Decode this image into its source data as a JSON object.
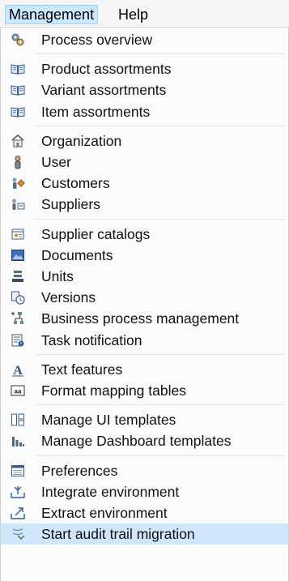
{
  "menubar": {
    "management": "Management",
    "help": "Help"
  },
  "menu": {
    "groups": [
      [
        {
          "label": "Process overview",
          "icon": "process-overview-icon"
        }
      ],
      [
        {
          "label": "Product assortments",
          "icon": "product-assortments-icon"
        },
        {
          "label": "Variant assortments",
          "icon": "variant-assortments-icon"
        },
        {
          "label": "Item assortments",
          "icon": "item-assortments-icon"
        }
      ],
      [
        {
          "label": "Organization",
          "icon": "organization-icon"
        },
        {
          "label": "User",
          "icon": "user-icon"
        },
        {
          "label": "Customers",
          "icon": "customers-icon"
        },
        {
          "label": "Suppliers",
          "icon": "suppliers-icon"
        }
      ],
      [
        {
          "label": "Supplier catalogs",
          "icon": "supplier-catalogs-icon"
        },
        {
          "label": "Documents",
          "icon": "documents-icon"
        },
        {
          "label": "Units",
          "icon": "units-icon"
        },
        {
          "label": "Versions",
          "icon": "versions-icon"
        },
        {
          "label": "Business process management",
          "icon": "business-process-management-icon"
        },
        {
          "label": "Task notification",
          "icon": "task-notification-icon"
        }
      ],
      [
        {
          "label": "Text features",
          "icon": "text-features-icon"
        },
        {
          "label": "Format mapping tables",
          "icon": "format-mapping-tables-icon"
        }
      ],
      [
        {
          "label": "Manage UI templates",
          "icon": "manage-ui-templates-icon"
        },
        {
          "label": "Manage Dashboard templates",
          "icon": "manage-dashboard-templates-icon"
        }
      ],
      [
        {
          "label": "Preferences",
          "icon": "preferences-icon"
        },
        {
          "label": "Integrate environment",
          "icon": "integrate-environment-icon"
        },
        {
          "label": "Extract environment",
          "icon": "extract-environment-icon"
        },
        {
          "label": "Start audit trail migration",
          "icon": "start-audit-trail-migration-icon",
          "highlighted": true
        }
      ]
    ]
  }
}
